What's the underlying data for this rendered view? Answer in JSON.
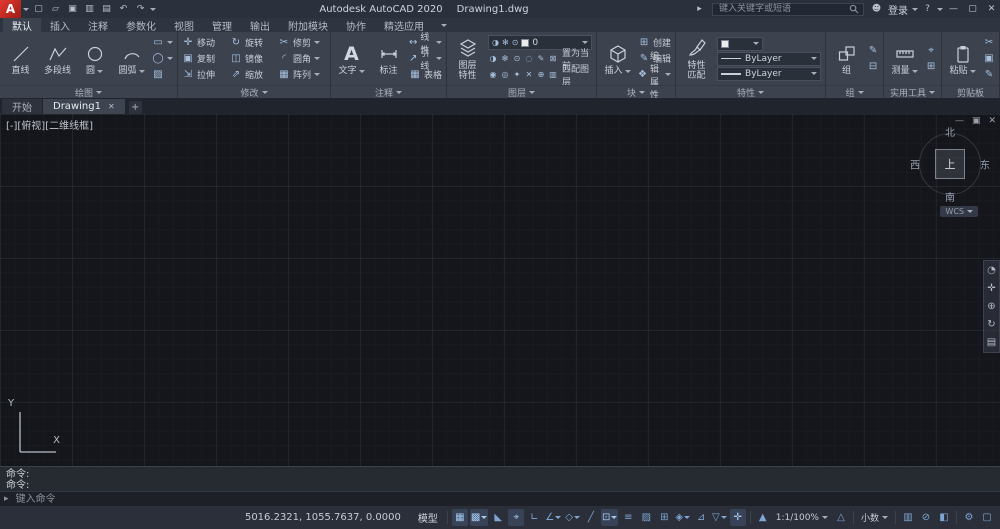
{
  "titlebar": {
    "logo": "A",
    "quick": [
      "▢",
      "▱",
      "▣",
      "▥",
      "▤",
      "↶",
      "↷"
    ],
    "app_title": "Autodesk AutoCAD 2020",
    "doc_title": "Drawing1.dwg",
    "collapse": "▸",
    "search_placeholder": "键入关键字或短语",
    "user_icon": "☻",
    "signin": "登录",
    "help": "?",
    "win_min": "—",
    "win_max": "▢",
    "win_close": "✕"
  },
  "tabs": [
    "默认",
    "插入",
    "注释",
    "参数化",
    "视图",
    "管理",
    "输出",
    "附加模块",
    "协作",
    "精选应用"
  ],
  "ribbon": {
    "draw": {
      "label": "绘图",
      "line": "直线",
      "polyline": "多段线",
      "circle": "圆",
      "arc": "圆弧",
      "extras": [
        "▭",
        "◯",
        "▨"
      ]
    },
    "modify": {
      "label": "修改",
      "items": [
        {
          "g": "✛",
          "t": "移动"
        },
        {
          "g": "↻",
          "t": "旋转"
        },
        {
          "g": "✂",
          "t": "修剪"
        },
        {
          "g": "▣",
          "t": "复制"
        },
        {
          "g": "◫",
          "t": "镜像"
        },
        {
          "g": "◜",
          "t": "圆角"
        },
        {
          "g": "⇲",
          "t": "拉伸"
        },
        {
          "g": "⇗",
          "t": "缩放"
        },
        {
          "g": "▦",
          "t": "阵列"
        }
      ]
    },
    "annot": {
      "label": "注释",
      "a": "A",
      "text": "文字",
      "dim": "标注",
      "rows": [
        {
          "g": "↔",
          "t": "线性"
        },
        {
          "g": "↗",
          "t": "引线"
        },
        {
          "g": "▦",
          "t": "表格"
        }
      ]
    },
    "layers": {
      "label": "图层",
      "big": "图层特性",
      "drop_icons": [
        "◑",
        "✻",
        "⊙"
      ],
      "current": "0",
      "row1_icons": [
        "◑",
        "✻",
        "⊙",
        "◌",
        "✎",
        "⊠"
      ],
      "row1_text": "置为当前",
      "row2_icons": [
        "◉",
        "◎",
        "✦",
        "✕",
        "⊕",
        "▥"
      ],
      "row2_text": "匹配图层"
    },
    "block": {
      "label": "块",
      "big": "插入",
      "rows": [
        {
          "g": "⊞",
          "t": "创建"
        },
        {
          "g": "✎",
          "t": "编辑"
        },
        {
          "g": "❖",
          "t": "编辑属性"
        }
      ]
    },
    "props": {
      "label": "特性",
      "big": "特性匹配",
      "bylayer": "ByLayer"
    },
    "group": {
      "label": "组",
      "big": "组",
      "minis": [
        "✎",
        "⊟"
      ]
    },
    "util": {
      "label": "实用工具",
      "big": "测量",
      "minis": [
        "⌖",
        "⊞"
      ]
    },
    "clip": {
      "label": "剪贴板",
      "big": "粘贴",
      "minis": [
        "✂",
        "▣",
        "✎"
      ]
    }
  },
  "filetabs": {
    "start": "开始",
    "doc": "Drawing1",
    "close": "✕",
    "add": "+"
  },
  "canvas": {
    "viewport": "[-][俯视][二维线框]",
    "win_min": "—",
    "win_restore": "▣",
    "win_close": "✕",
    "cube": {
      "n": "北",
      "s": "南",
      "w": "西",
      "e": "东",
      "center": "上"
    },
    "wcs": "WCS",
    "nav": [
      "◔",
      "✛",
      "⊕",
      "↻",
      "▤"
    ],
    "ucs_x": "X",
    "ucs_y": "Y"
  },
  "command": {
    "line1": "命令:",
    "line2": "命令:",
    "icon": "▸",
    "placeholder": "键入命令"
  },
  "status": {
    "coords": "5016.2321, 1055.7637, 0.0000",
    "model": "模型",
    "left": [
      {
        "g": "▦"
      },
      {
        "g": "▩"
      },
      {
        "g": "◣"
      },
      {
        "g": "⌖"
      },
      {
        "g": "∟"
      },
      {
        "g": "∠"
      },
      {
        "g": "◇"
      },
      {
        "g": "╱"
      },
      {
        "g": "⊡"
      },
      {
        "g": "≡"
      },
      {
        "g": "▨"
      },
      {
        "g": "⊞"
      },
      {
        "g": "◈"
      },
      {
        "g": "⊿"
      },
      {
        "g": "▽"
      },
      {
        "g": "✛"
      }
    ],
    "ann_vis": "▲",
    "scale": "1:1/100%",
    "ann_auto": "△",
    "units": "小数",
    "right": [
      {
        "g": "▥"
      },
      {
        "g": "⊘"
      },
      {
        "g": "◧"
      },
      {
        "g": "⚙"
      },
      {
        "g": "▢"
      }
    ]
  }
}
